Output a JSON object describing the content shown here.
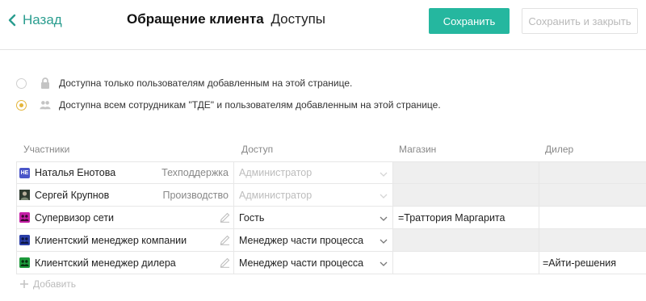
{
  "header": {
    "back_label": "Назад",
    "title_main": "Обращение клиента",
    "title_sub": "Доступы",
    "save_label": "Сохранить",
    "save_close_label": "Сохранить и закрыть"
  },
  "access_options": [
    {
      "label": "Доступна только пользователям добавленным на этой странице.",
      "icon": "lock-icon",
      "checked": false
    },
    {
      "label": "Доступна всем сотрудникам \"ТДЕ\" и пользователям добавленным на этой странице.",
      "icon": "users-icon",
      "checked": true
    }
  ],
  "table": {
    "headers": {
      "participants": "Участники",
      "access": "Доступ",
      "shop": "Магазин",
      "dealer": "Дилер"
    },
    "rows": [
      {
        "name": "Наталья Енотова",
        "avatar_text": "НЕ",
        "avatar_color": "#4a55c8",
        "role": "Техподдержка",
        "access": "Администратор",
        "access_disabled": true,
        "shop": "",
        "dealer": "",
        "editable": false
      },
      {
        "name": "Сергей Крупнов",
        "avatar_text": "",
        "avatar_color": "#3c4a3a",
        "role": "Производство",
        "access": "Администратор",
        "access_disabled": true,
        "shop": "",
        "dealer": "",
        "editable": false
      },
      {
        "name": "Супервизор сети",
        "avatar_text": "",
        "avatar_color": "#c51fa6",
        "role": "",
        "access": "Гость",
        "access_disabled": false,
        "shop": "=Траттория Маргарита",
        "dealer": "",
        "editable": true
      },
      {
        "name": "Клиентский менеджер компании",
        "avatar_text": "",
        "avatar_color": "#2b3fa8",
        "role": "",
        "access": "Менеджер части процесса",
        "access_disabled": false,
        "shop": "",
        "dealer": "",
        "editable": true
      },
      {
        "name": "Клиентский менеджер дилера",
        "avatar_text": "",
        "avatar_color": "#1e9a3c",
        "role": "",
        "access": "Менеджер части процесса",
        "access_disabled": false,
        "shop": "",
        "dealer": "=Айти-решения",
        "editable": true
      }
    ]
  },
  "add_label": "Добавить",
  "colors": {
    "accent": "#25b79f",
    "link": "#2a9d8f",
    "radio_checked": "#e4b53a"
  }
}
